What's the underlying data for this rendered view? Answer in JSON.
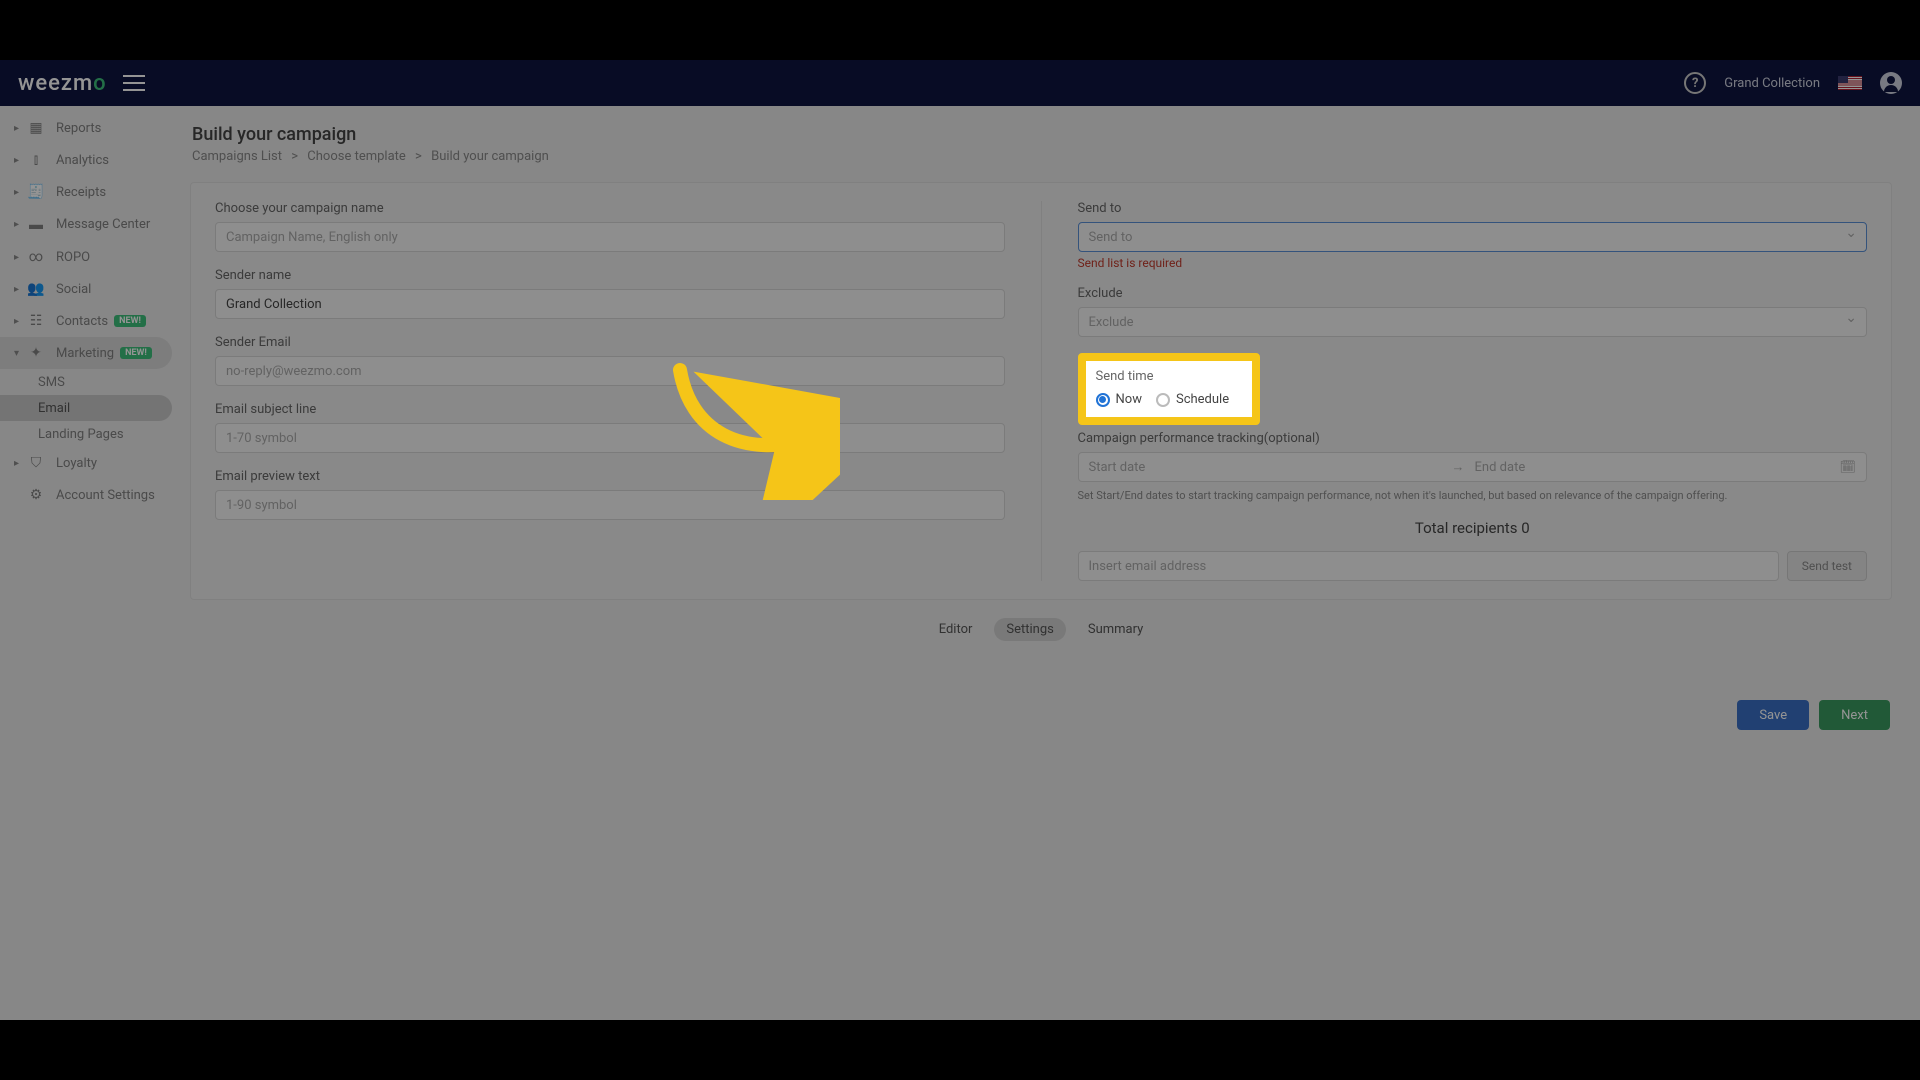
{
  "brand": {
    "name": "weezm",
    "accent_letter": "o"
  },
  "header": {
    "user_label": "Grand Collection"
  },
  "sidebar": {
    "items": [
      {
        "label": "Reports"
      },
      {
        "label": "Analytics"
      },
      {
        "label": "Receipts"
      },
      {
        "label": "Message Center"
      },
      {
        "label": "ROPO"
      },
      {
        "label": "Social"
      },
      {
        "label": "Contacts",
        "badge": "NEW!"
      },
      {
        "label": "Marketing",
        "badge": "NEW!",
        "expanded": true
      },
      {
        "label": "Loyalty"
      },
      {
        "label": "Account Settings"
      }
    ],
    "marketing_sub": [
      {
        "label": "SMS"
      },
      {
        "label": "Email",
        "active": true
      },
      {
        "label": "Landing Pages"
      }
    ]
  },
  "page": {
    "title": "Build your campaign",
    "breadcrumb": [
      "Campaigns List",
      "Choose template",
      "Build your campaign"
    ]
  },
  "form": {
    "campaign_name": {
      "label": "Choose your campaign name",
      "placeholder": "Campaign Name, English only",
      "value": ""
    },
    "sender_name": {
      "label": "Sender name",
      "value": "Grand Collection"
    },
    "sender_email": {
      "label": "Sender Email",
      "placeholder": "no-reply@weezmo.com",
      "value": ""
    },
    "subject": {
      "label": "Email subject line",
      "placeholder": "1-70 symbol",
      "value": ""
    },
    "preview": {
      "label": "Email preview text",
      "placeholder": "1-90 symbol",
      "value": ""
    }
  },
  "right": {
    "send_to": {
      "label": "Send to",
      "placeholder": "Send to",
      "error": "Send list is required"
    },
    "exclude": {
      "label": "Exclude",
      "placeholder": "Exclude"
    },
    "send_time": {
      "label": "Send time",
      "option_now": "Now",
      "option_schedule": "Schedule",
      "selected": "now"
    },
    "tracking": {
      "label": "Campaign performance tracking(optional)",
      "start_placeholder": "Start date",
      "end_placeholder": "End date",
      "help": "Set Start/End dates to start tracking campaign performance, not when it's launched, but based on relevance of the campaign offering."
    },
    "total_recipients": {
      "label": "Total recipients",
      "count": "0"
    },
    "test": {
      "placeholder": "Insert email address",
      "button": "Send test"
    }
  },
  "tabs": {
    "editor": "Editor",
    "settings": "Settings",
    "summary": "Summary"
  },
  "buttons": {
    "save": "Save",
    "next": "Next"
  }
}
